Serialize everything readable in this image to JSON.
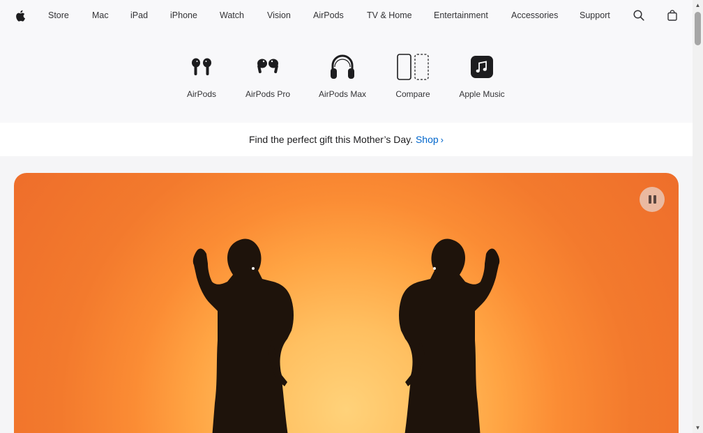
{
  "globalnav": {
    "items": [
      {
        "label": "Store"
      },
      {
        "label": "Mac"
      },
      {
        "label": "iPad"
      },
      {
        "label": "iPhone"
      },
      {
        "label": "Watch"
      },
      {
        "label": "Vision"
      },
      {
        "label": "AirPods"
      },
      {
        "label": "TV & Home"
      },
      {
        "label": "Entertainment"
      },
      {
        "label": "Accessories"
      },
      {
        "label": "Support"
      }
    ],
    "icons": [
      "apple-logo",
      "search-icon",
      "bag-icon"
    ]
  },
  "chapternav": {
    "items": [
      {
        "label": "AirPods",
        "icon": "airpods-icon"
      },
      {
        "label": "AirPods Pro",
        "icon": "airpods-pro-icon"
      },
      {
        "label": "AirPods Max",
        "icon": "airpods-max-icon"
      },
      {
        "label": "Compare",
        "icon": "compare-icon"
      },
      {
        "label": "Apple Music",
        "icon": "apple-music-icon"
      }
    ]
  },
  "ribbon": {
    "text": "Find the perfect gift this Mother’s Day.",
    "link": "Shop",
    "link_chevron": "›",
    "link_color": "#0066cc"
  },
  "hero": {
    "pause_icon": "pause-icon",
    "accent": "#f37a2d"
  }
}
